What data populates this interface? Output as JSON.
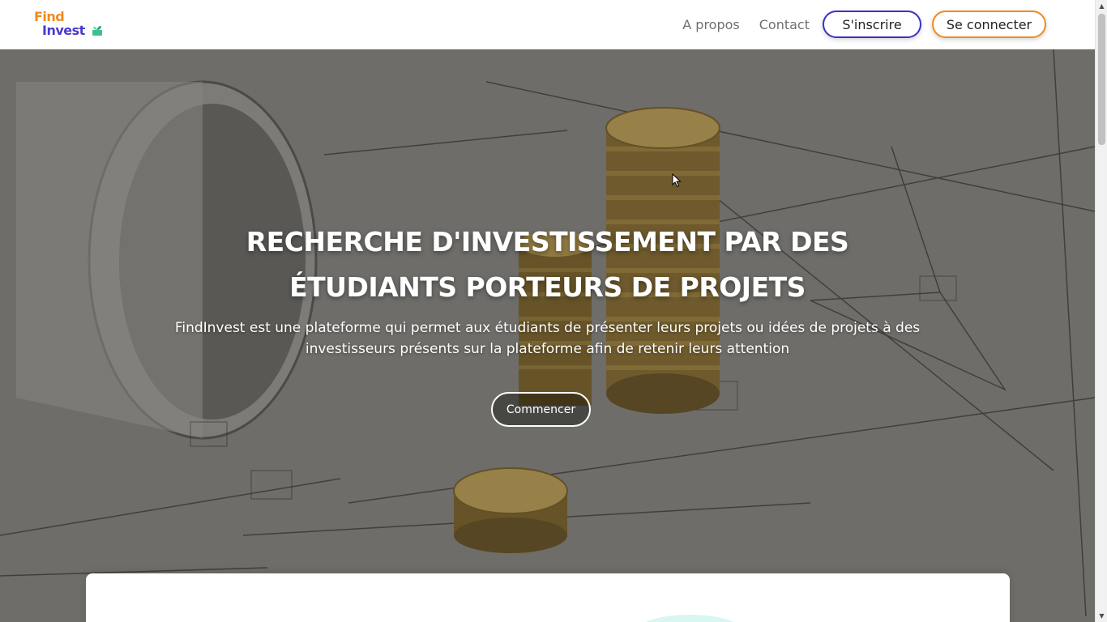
{
  "header": {
    "logo_find": "Find",
    "logo_invest": "Invest",
    "logo_icon": "money-plant-icon",
    "nav": [
      {
        "label": "A propos"
      },
      {
        "label": "Contact"
      }
    ],
    "register_label": "S'inscrire",
    "login_label": "Se connecter"
  },
  "hero": {
    "title": "RECHERCHE D'INVESTISSEMENT PAR DES ÉTUDIANTS PORTEURS DE PROJETS",
    "description": "FindInvest est une plateforme qui permet aux étudiants de présenter leurs projets ou idées de projets à des investisseurs présents sur la plateforme afin de retenir leurs attention",
    "cta_label": "Commencer"
  },
  "colors": {
    "brand_orange": "#f28a1c",
    "brand_purple": "#3b31c6",
    "text_white": "#ffffff"
  }
}
